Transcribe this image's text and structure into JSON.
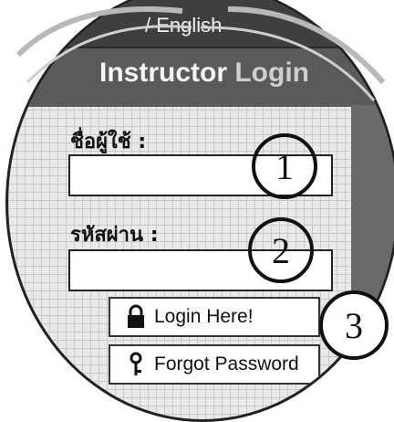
{
  "language_switch": {
    "label": "/ English"
  },
  "panel": {
    "title_part1": "Instructor",
    "title_part2": "Login"
  },
  "form": {
    "username_label": "ชื่อผู้ใช้ :",
    "username_value": "",
    "password_label": "รหัสผ่าน :",
    "password_value": ""
  },
  "buttons": {
    "login_label": "Login Here!",
    "forgot_label": "Forgot Password"
  },
  "callouts": [
    "1",
    "2",
    "3"
  ],
  "colors": {
    "header_bg": "#5a5a5a",
    "lang_bar_bg": "#3f3f3f",
    "grid_bg": "#e9e9e9"
  }
}
